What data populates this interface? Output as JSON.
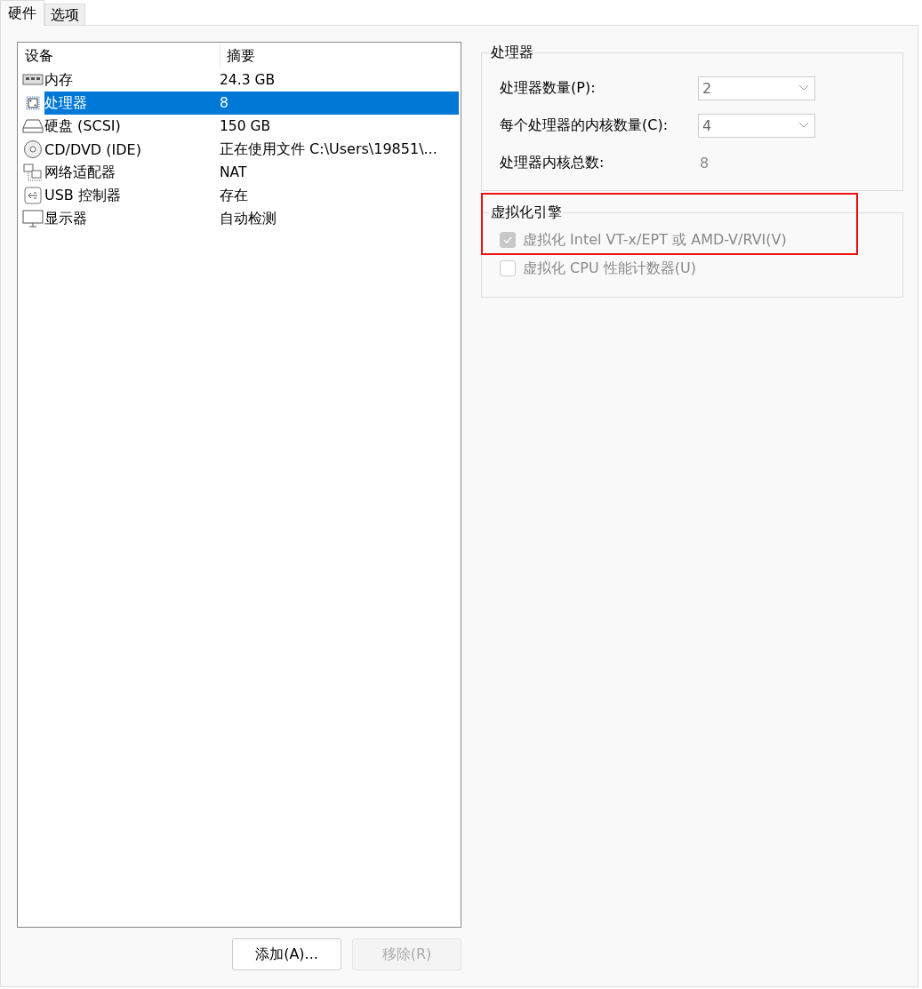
{
  "tabs": [
    {
      "label": "硬件",
      "selected": true
    },
    {
      "label": "选项",
      "selected": false
    }
  ],
  "device_list": {
    "columns": [
      "设备",
      "摘要"
    ],
    "rows": [
      {
        "kind": "memory",
        "device": "内存",
        "summary": "24.3 GB",
        "selected": false
      },
      {
        "kind": "processor",
        "device": "处理器",
        "summary": "8",
        "selected": true
      },
      {
        "kind": "disk",
        "device": "硬盘 (SCSI)",
        "summary": "150 GB",
        "selected": false
      },
      {
        "kind": "cd",
        "device": "CD/DVD (IDE)",
        "summary": "正在使用文件 C:\\Users\\19851\\...",
        "selected": false
      },
      {
        "kind": "network",
        "device": "网络适配器",
        "summary": "NAT",
        "selected": false
      },
      {
        "kind": "usb",
        "device": "USB 控制器",
        "summary": "存在",
        "selected": false
      },
      {
        "kind": "display",
        "device": "显示器",
        "summary": "自动检测",
        "selected": false
      }
    ]
  },
  "processor_group": {
    "title": "处理器",
    "fields": [
      {
        "kind": "dropdown",
        "label": "处理器数量(P):",
        "value": "2"
      },
      {
        "kind": "dropdown",
        "label": "每个处理器的内核数量(C):",
        "value": "4"
      },
      {
        "kind": "readout",
        "label": "处理器内核总数:",
        "value": "8"
      }
    ]
  },
  "virtualization_group": {
    "title": "虚拟化引擎",
    "highlighted": true,
    "options": [
      {
        "label": "虚拟化 Intel VT-x/EPT 或 AMD-V/RVI(V)",
        "checked": true,
        "disabled": true
      },
      {
        "label": "虚拟化 CPU 性能计数器(U)",
        "checked": false,
        "disabled": true
      }
    ]
  },
  "buttons": [
    {
      "label": "添加(A)...",
      "disabled": false
    },
    {
      "label": "移除(R)",
      "disabled": true
    }
  ]
}
